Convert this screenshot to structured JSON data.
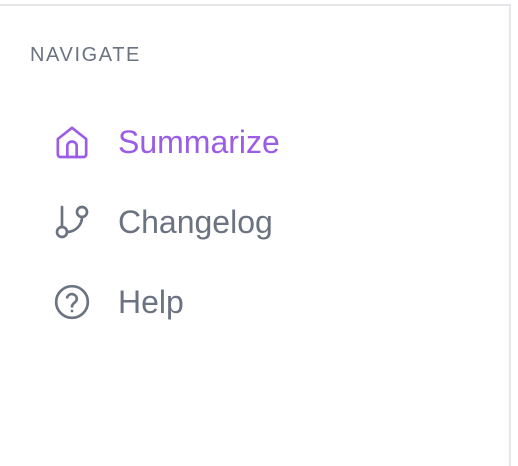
{
  "sidebar": {
    "section_title": "NAVIGATE",
    "items": [
      {
        "label": "Summarize",
        "icon": "home-icon",
        "active": true
      },
      {
        "label": "Changelog",
        "icon": "git-branch-icon",
        "active": false
      },
      {
        "label": "Help",
        "icon": "help-circle-icon",
        "active": false
      }
    ]
  },
  "colors": {
    "active": "#9b5de5",
    "inactive": "#6b7280",
    "border": "#e5e7eb",
    "background": "#ffffff"
  }
}
